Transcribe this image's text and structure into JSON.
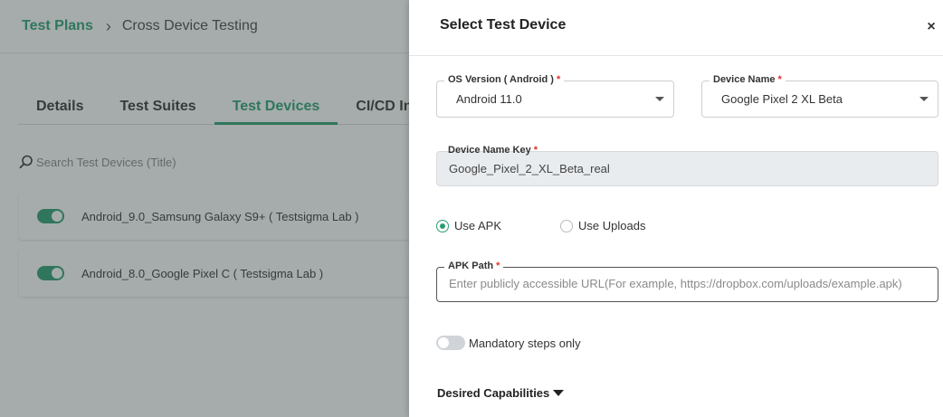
{
  "breadcrumb": {
    "root": "Test Plans",
    "separator": "›",
    "current": "Cross Device Testing"
  },
  "tabs": [
    {
      "label": "Details",
      "active": false
    },
    {
      "label": "Test Suites",
      "active": false
    },
    {
      "label": "Test Devices",
      "active": true
    },
    {
      "label": "CI/CD In",
      "active": false
    }
  ],
  "search": {
    "placeholder": "Search Test Devices (Title)",
    "icon": "search-icon"
  },
  "devices": [
    {
      "label": "Android_9.0_Samsung Galaxy S9+ ( Testsigma Lab )",
      "enabled": true
    },
    {
      "label": "Android_8.0_Google Pixel C ( Testsigma Lab )",
      "enabled": true
    }
  ],
  "drawer": {
    "title": "Select Test Device",
    "close_glyph": "×",
    "os_version": {
      "label": "OS Version ( Android )",
      "required_mark": "*",
      "value": "Android 11.0"
    },
    "device_name": {
      "label": "Device Name",
      "required_mark": "*",
      "value": "Google Pixel 2 XL Beta"
    },
    "device_name_key": {
      "label": "Device Name Key",
      "required_mark": "*",
      "value": "Google_Pixel_2_XL_Beta_real"
    },
    "upload_options": [
      {
        "label": "Use APK",
        "selected": true
      },
      {
        "label": "Use Uploads",
        "selected": false
      }
    ],
    "apk_path": {
      "label": "APK Path",
      "required_mark": "*",
      "value": "",
      "placeholder": "Enter publicly accessible URL(For example, https://dropbox.com/uploads/example.apk)"
    },
    "mandatory_steps": {
      "label": "Mandatory steps only",
      "enabled": false
    },
    "desired_capabilities": {
      "label": "Desired Capabilities"
    }
  },
  "colors": {
    "accent": "#2a9d6f",
    "required": "#e0302e",
    "overlay": "rgba(55,71,69,0.45)"
  }
}
